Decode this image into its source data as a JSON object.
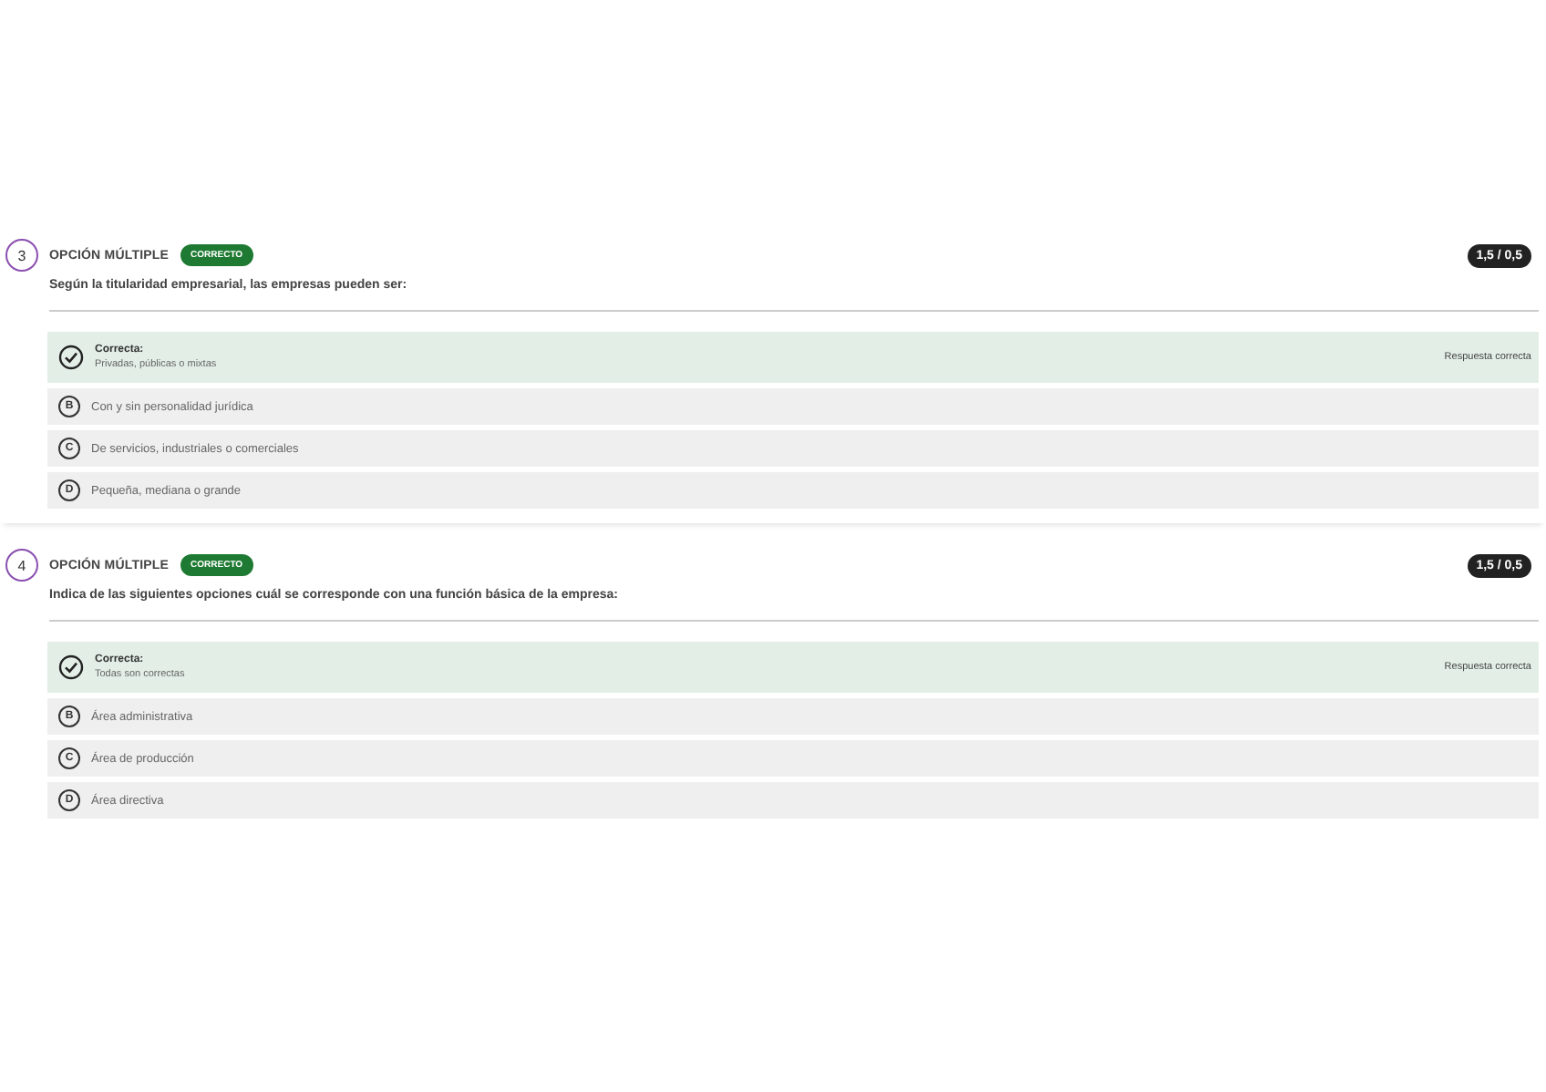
{
  "questions": [
    {
      "number": "3",
      "type": "OPCIÓN MÚLTIPLE",
      "status": "CORRECTO",
      "score": "1,5 / 0,5",
      "prompt": "Según la titularidad empresarial, las empresas pueden ser:",
      "options": [
        {
          "kind": "correct",
          "heading": "Correcta:",
          "label": "Privadas, públicas o mixtas",
          "feedback": "Respuesta correcta"
        },
        {
          "kind": "option",
          "letter": "B",
          "label": "Con y sin personalidad jurídica"
        },
        {
          "kind": "option",
          "letter": "C",
          "label": "De servicios, industriales o comerciales"
        },
        {
          "kind": "option",
          "letter": "D",
          "label": "Pequeña, mediana o grande"
        }
      ]
    },
    {
      "number": "4",
      "type": "OPCIÓN MÚLTIPLE",
      "status": "CORRECTO",
      "score": "1,5 / 0,5",
      "prompt": "Indica de las siguientes opciones cuál se corresponde con una función básica de la empresa:",
      "options": [
        {
          "kind": "correct",
          "heading": "Correcta:",
          "label": "Todas son correctas",
          "feedback": "Respuesta correcta"
        },
        {
          "kind": "option",
          "letter": "B",
          "label": "Área administrativa"
        },
        {
          "kind": "option",
          "letter": "C",
          "label": "Área de producción"
        },
        {
          "kind": "option",
          "letter": "D",
          "label": "Área directiva"
        }
      ]
    }
  ]
}
